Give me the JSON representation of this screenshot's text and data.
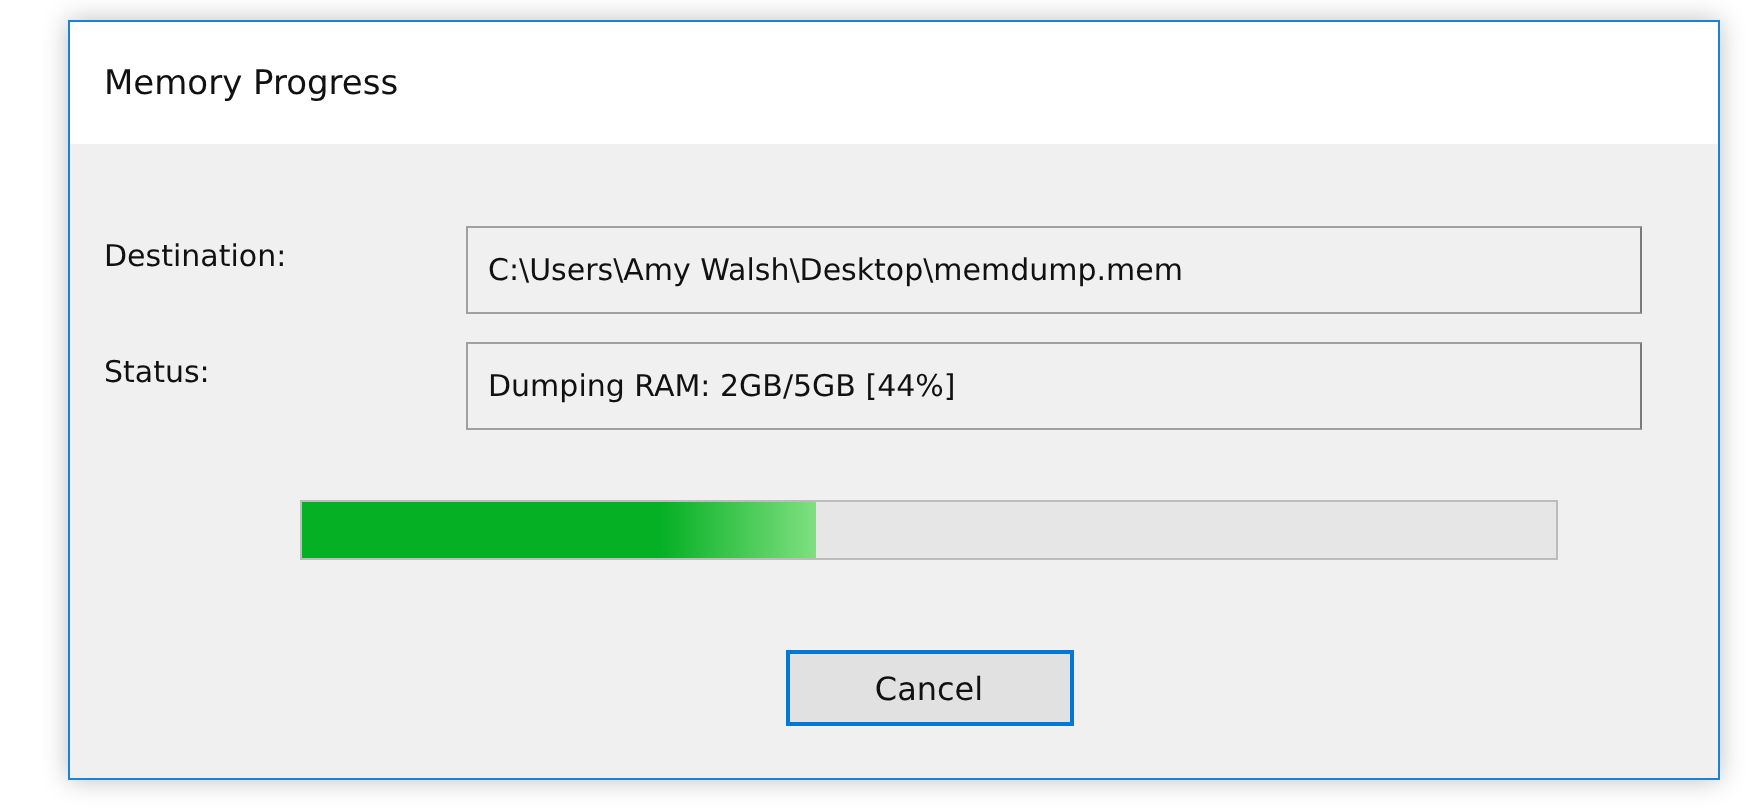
{
  "window": {
    "title": "Memory Progress"
  },
  "fields": [
    {
      "label": "Destination:",
      "value": "C:\\Users\\Amy Walsh\\Desktop\\memdump.mem"
    },
    {
      "label": "Status:",
      "value": "Dumping RAM: 2GB/5GB [44%]"
    }
  ],
  "progress": {
    "level": 0.41
  },
  "buttons": [
    {
      "label": "Cancel",
      "focused": true
    }
  ]
}
